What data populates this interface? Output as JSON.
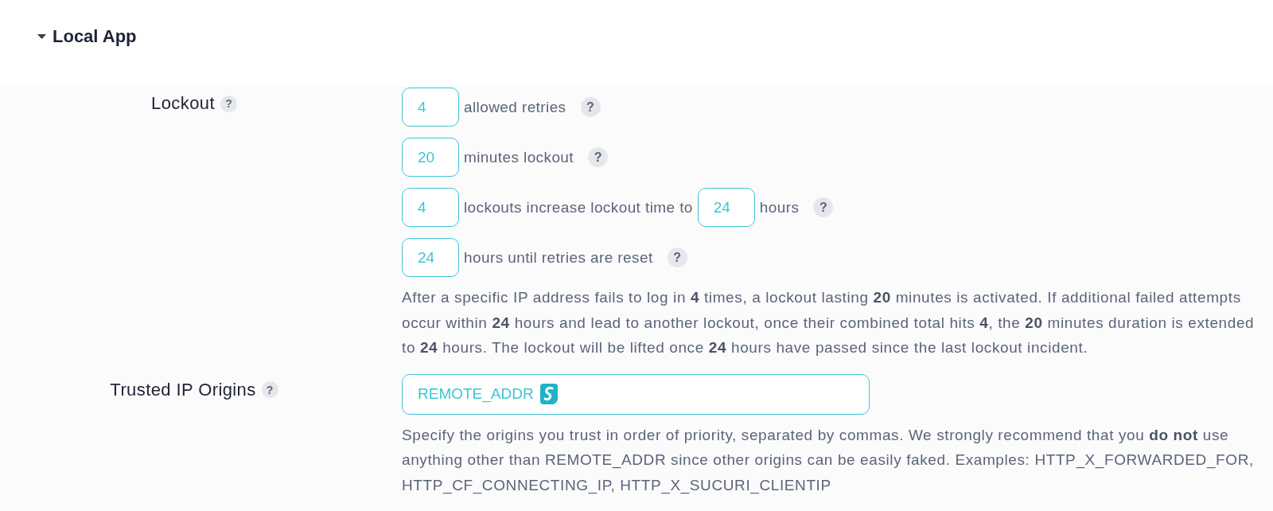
{
  "section": {
    "title": "Local App",
    "expanded": true
  },
  "settings": [
    {
      "label": "Lockout",
      "help": "?",
      "rows": [
        {
          "parts": [
            {
              "kind": "field",
              "value": "4"
            },
            {
              "kind": "text",
              "text": "allowed retries"
            }
          ],
          "help": "?"
        },
        {
          "parts": [
            {
              "kind": "field",
              "value": "20"
            },
            {
              "kind": "text",
              "text": "minutes lockout"
            }
          ],
          "help": "?"
        },
        {
          "parts": [
            {
              "kind": "field",
              "value": "4"
            },
            {
              "kind": "text",
              "text": "lockouts increase lockout time to"
            },
            {
              "kind": "field",
              "value": "24"
            },
            {
              "kind": "text",
              "text": "hours"
            }
          ],
          "help": "?"
        },
        {
          "parts": [
            {
              "kind": "field",
              "value": "24"
            },
            {
              "kind": "text",
              "text": "hours until retries are reset"
            }
          ],
          "help": "?"
        }
      ],
      "description": "After a specific IP address fails to log in **4** times, a lockout lasting **20** minutes is activated. If additional failed attempts occur within **24** hours and lead to another lockout, once their combined total hits **4**, the **20** minutes duration is extended to **24** hours. The lockout will be lifted once **24** hours have passed since the last lockout incident."
    },
    {
      "label": "Trusted IP Origins",
      "help": "?",
      "rows": [
        {
          "parts": [
            {
              "kind": "wide-field",
              "value": "REMOTE_ADDR",
              "extension_badge": true
            }
          ]
        }
      ],
      "description": "Specify the origins you trust in order of priority, separated by commas. We strongly recommend that you **do not** use anything other than REMOTE_ADDR since other origins can be easily faked. Examples: HTTP_X_FORWARDED_FOR, HTTP_CF_CONNECTING_IP, HTTP_X_SUCURI_CLIENTIP"
    }
  ]
}
